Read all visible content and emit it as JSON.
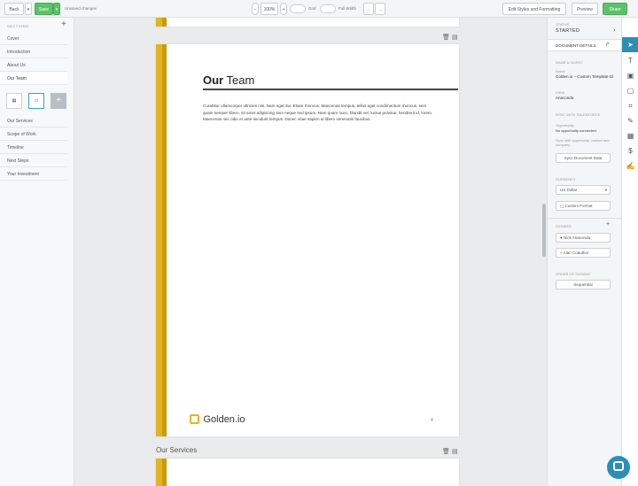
{
  "topbar": {
    "back_label": "Back",
    "save_label": "Save",
    "status_text": "Unsaved changes",
    "zoom_value": "100%",
    "grid_label": "Grid",
    "fullwidth_label": "Full Width",
    "edit_styles_label": "Edit Styles and Formatting",
    "preview_label": "Preview",
    "share_label": "Share"
  },
  "sidebar": {
    "heading": "SECTIONS",
    "add_label": "+",
    "items": [
      {
        "label": "Cover"
      },
      {
        "label": "Introduction"
      },
      {
        "label": "About Us"
      },
      {
        "label": "Our Team"
      },
      {
        "label": "Our Services"
      },
      {
        "label": "Scope of Work"
      },
      {
        "label": "Timeline"
      },
      {
        "label": "Next Steps"
      },
      {
        "label": "Your Investment"
      }
    ],
    "thumb_add_label": "+"
  },
  "page": {
    "title_bold": "Our",
    "title_rest": " Team",
    "body": "Curabitur ullamcorper ultricies nisi. Nam eget dui. Etiam rhoncus. Maecenas tempus, tellus eget condimentum rhoncus, sem quam semper libero, sit amet adipiscing sem neque sed ipsum. Nam quam nunc, blandit vel, luctus pulvinar, hendrerit id, lorem. Maecenas nec odio et ante tincidunt tempus. Donec vitae sapien ut libero venenatis faucibus.",
    "logo_text": "Golden.io",
    "page_number": "4"
  },
  "next_section": {
    "label": "Our Services"
  },
  "right_panel": {
    "status_label": "STATUS",
    "status_value": "STARTED",
    "tab_label": "DOCUMENT DETAILS",
    "name_client": "NAME & CLIENT",
    "name_label": "Name",
    "name_value": "Golden.io – Custom Template 02",
    "client_label": "Client",
    "client_value": "Anaconda",
    "sync_heading": "SYNC WITH SALESFORCE",
    "opp_label": "Opportunity",
    "opp_value": "No opportunity connected",
    "sync_hint": "Sync with opportunity, contact and company",
    "sync_btn": "Sync Document Data",
    "currency_label": "CURRENCY",
    "currency_value": "US Dollar",
    "custom_format": "Custom Format",
    "signees_label": "SIGNEES",
    "signee1": "Nick Anaconda",
    "signee2": "Alan Coauthor",
    "signed_label": "ORDER OF SIGNING",
    "signed_btn": "Sequential"
  },
  "colors": {
    "accent_green": "#5cc26a",
    "stripe_gold": "#e3b422",
    "stripe_dark_gold": "#c99b0c",
    "link_blue": "#2e6fb5",
    "chat_blue": "#2a8fb6"
  }
}
